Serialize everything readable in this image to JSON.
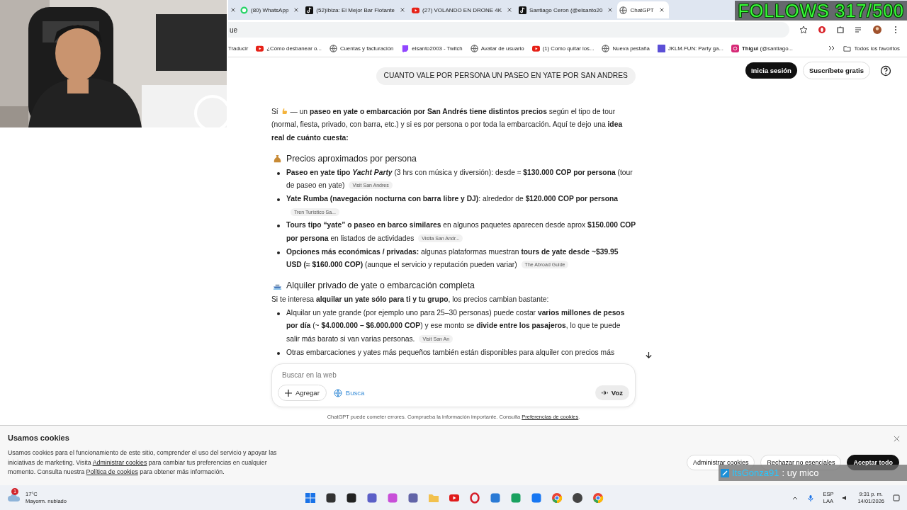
{
  "overlay": {
    "follows": "FOLLOWS 317/500",
    "chat_user": "ItsGonza91",
    "chat_message": ": uy mico"
  },
  "tabs": [
    {
      "label": "(80) WhatsApp",
      "kind": "chat",
      "selected": false
    },
    {
      "label": "(52)Ibiza: El Mejor Bar Flotante",
      "kind": "note",
      "selected": false
    },
    {
      "label": "(27) VOLANDO EN DRONE 4K",
      "kind": "play",
      "selected": false
    },
    {
      "label": "Santiago Ceron (@elsanto20",
      "kind": "note",
      "selected": false
    },
    {
      "label": "ChatGPT",
      "kind": "globe",
      "selected": true
    }
  ],
  "address_bar": {
    "value": "ue"
  },
  "bookmarks": [
    {
      "label": "Traducir",
      "kind": "plain"
    },
    {
      "label": "¿Cómo desbanear o...",
      "kind": "play"
    },
    {
      "label": "Cuentas y facturación",
      "kind": "globe"
    },
    {
      "label": "elsanto2003 - Twitch",
      "kind": "stream"
    },
    {
      "label": "Avatar de usuario",
      "kind": "globe"
    },
    {
      "label": "(1) Como quitar los...",
      "kind": "play"
    },
    {
      "label": "Nueva pestaña",
      "kind": "globe"
    },
    {
      "label": "JKLM.FUN: Party ga...",
      "kind": "tile"
    },
    {
      "label": "**Thigui** (@santiago...",
      "kind": "camera"
    }
  ],
  "all_bookmarks": "Todos los favoritos",
  "header": {
    "login": "Inicia sesión",
    "subscribe": "Suscríbete gratis"
  },
  "user_message": "CUANTO VALE POR PERSONA UN PASEO EN YATE POR SAN ANDRES",
  "answer": {
    "intro": "Sí",
    "intro_rest": "— un **paseo en yate o embarcación por San Andrés tiene distintos precios** según el tipo de tour (normal, fiesta, privado, con barra, etc.) y si es por persona o por toda la embarcación. Aquí te dejo una **idea real de cuánto cuesta:**",
    "sections": [
      {
        "heading": "Precios aproximados por persona",
        "kind": "bag",
        "items": [
          {
            "text": "**Paseo en yate tipo** *Yacht Party* (3 hrs con música y diversión): desde ≈ **$130.000 COP por persona** (tour de paseo en yate)",
            "source": "Visit San Andres"
          },
          {
            "text": "**Yate Rumba (navegación nocturna con barra libre y DJ)**: alrededor de **$120.000 COP por persona**",
            "source": "Tren Turístico Sa..."
          },
          {
            "text": "**Tours tipo “yate” o paseo en barco similares** en algunos paquetes aparecen desde aprox **$150.000 COP por persona** en listados de actividades",
            "source": "Visita San Andr..."
          },
          {
            "text": "**Opciones más económicas / privadas:** algunas plataformas muestran **tours de yate desde ~$39.95 USD (≈ $160.000 COP)** (aunque el servicio y reputación pueden variar)",
            "source": "The Abroad Guide"
          }
        ]
      },
      {
        "heading": "Alquiler privado de yate o embarcación completa",
        "kind": "ship",
        "lead": "Si te interesa **alquilar un yate sólo para ti y tu grupo**, los precios cambian bastante:",
        "items": [
          {
            "text": "Alquilar un yate grande (por ejemplo uno para 25–30 personas) puede costar **varios millones de pesos por día** (~ **$4.000.000 – $6.000.000 COP**) y ese monto se **divide entre los pasajeros**, lo que te puede salir más barato si van varias personas.",
            "source": "Visit San An"
          },
          {
            "text": "Otras embarcaciones y yates más pequeños también están disponibles para alquiler con precios más"
          }
        ]
      }
    ]
  },
  "composer": {
    "placeholder": "Buscar en la web",
    "add": "Agregar",
    "search": "Busca",
    "voice": "Voz"
  },
  "disclaimer": {
    "text": "ChatGPT puede cometer errores. Comprueba la información importante. Consulta",
    "link": "Preferencias de cookies",
    "end": "."
  },
  "cookies": {
    "title": "Usamos cookies",
    "text_before": "Usamos cookies para el funcionamiento de este sitio, comprender el uso del servicio y apoyar las iniciativas de marketing. Visita",
    "link1": "Administrar cookies",
    "text_middle": "para cambiar tus preferencias en cualquier momento. Consulta nuestra",
    "link2": "Política de cookies",
    "text_after": "para obtener más información.",
    "buttons": [
      "Administrar cookies",
      "Rechazar no esenciales",
      "Aceptar todo"
    ]
  },
  "taskbar": {
    "weather_badge": "1",
    "temperature": "17°C",
    "weather": "Mayorm. nublado",
    "language": "ESP",
    "layout": "LAA",
    "time": "9:31 p. m.",
    "date": "14/01/2026"
  }
}
